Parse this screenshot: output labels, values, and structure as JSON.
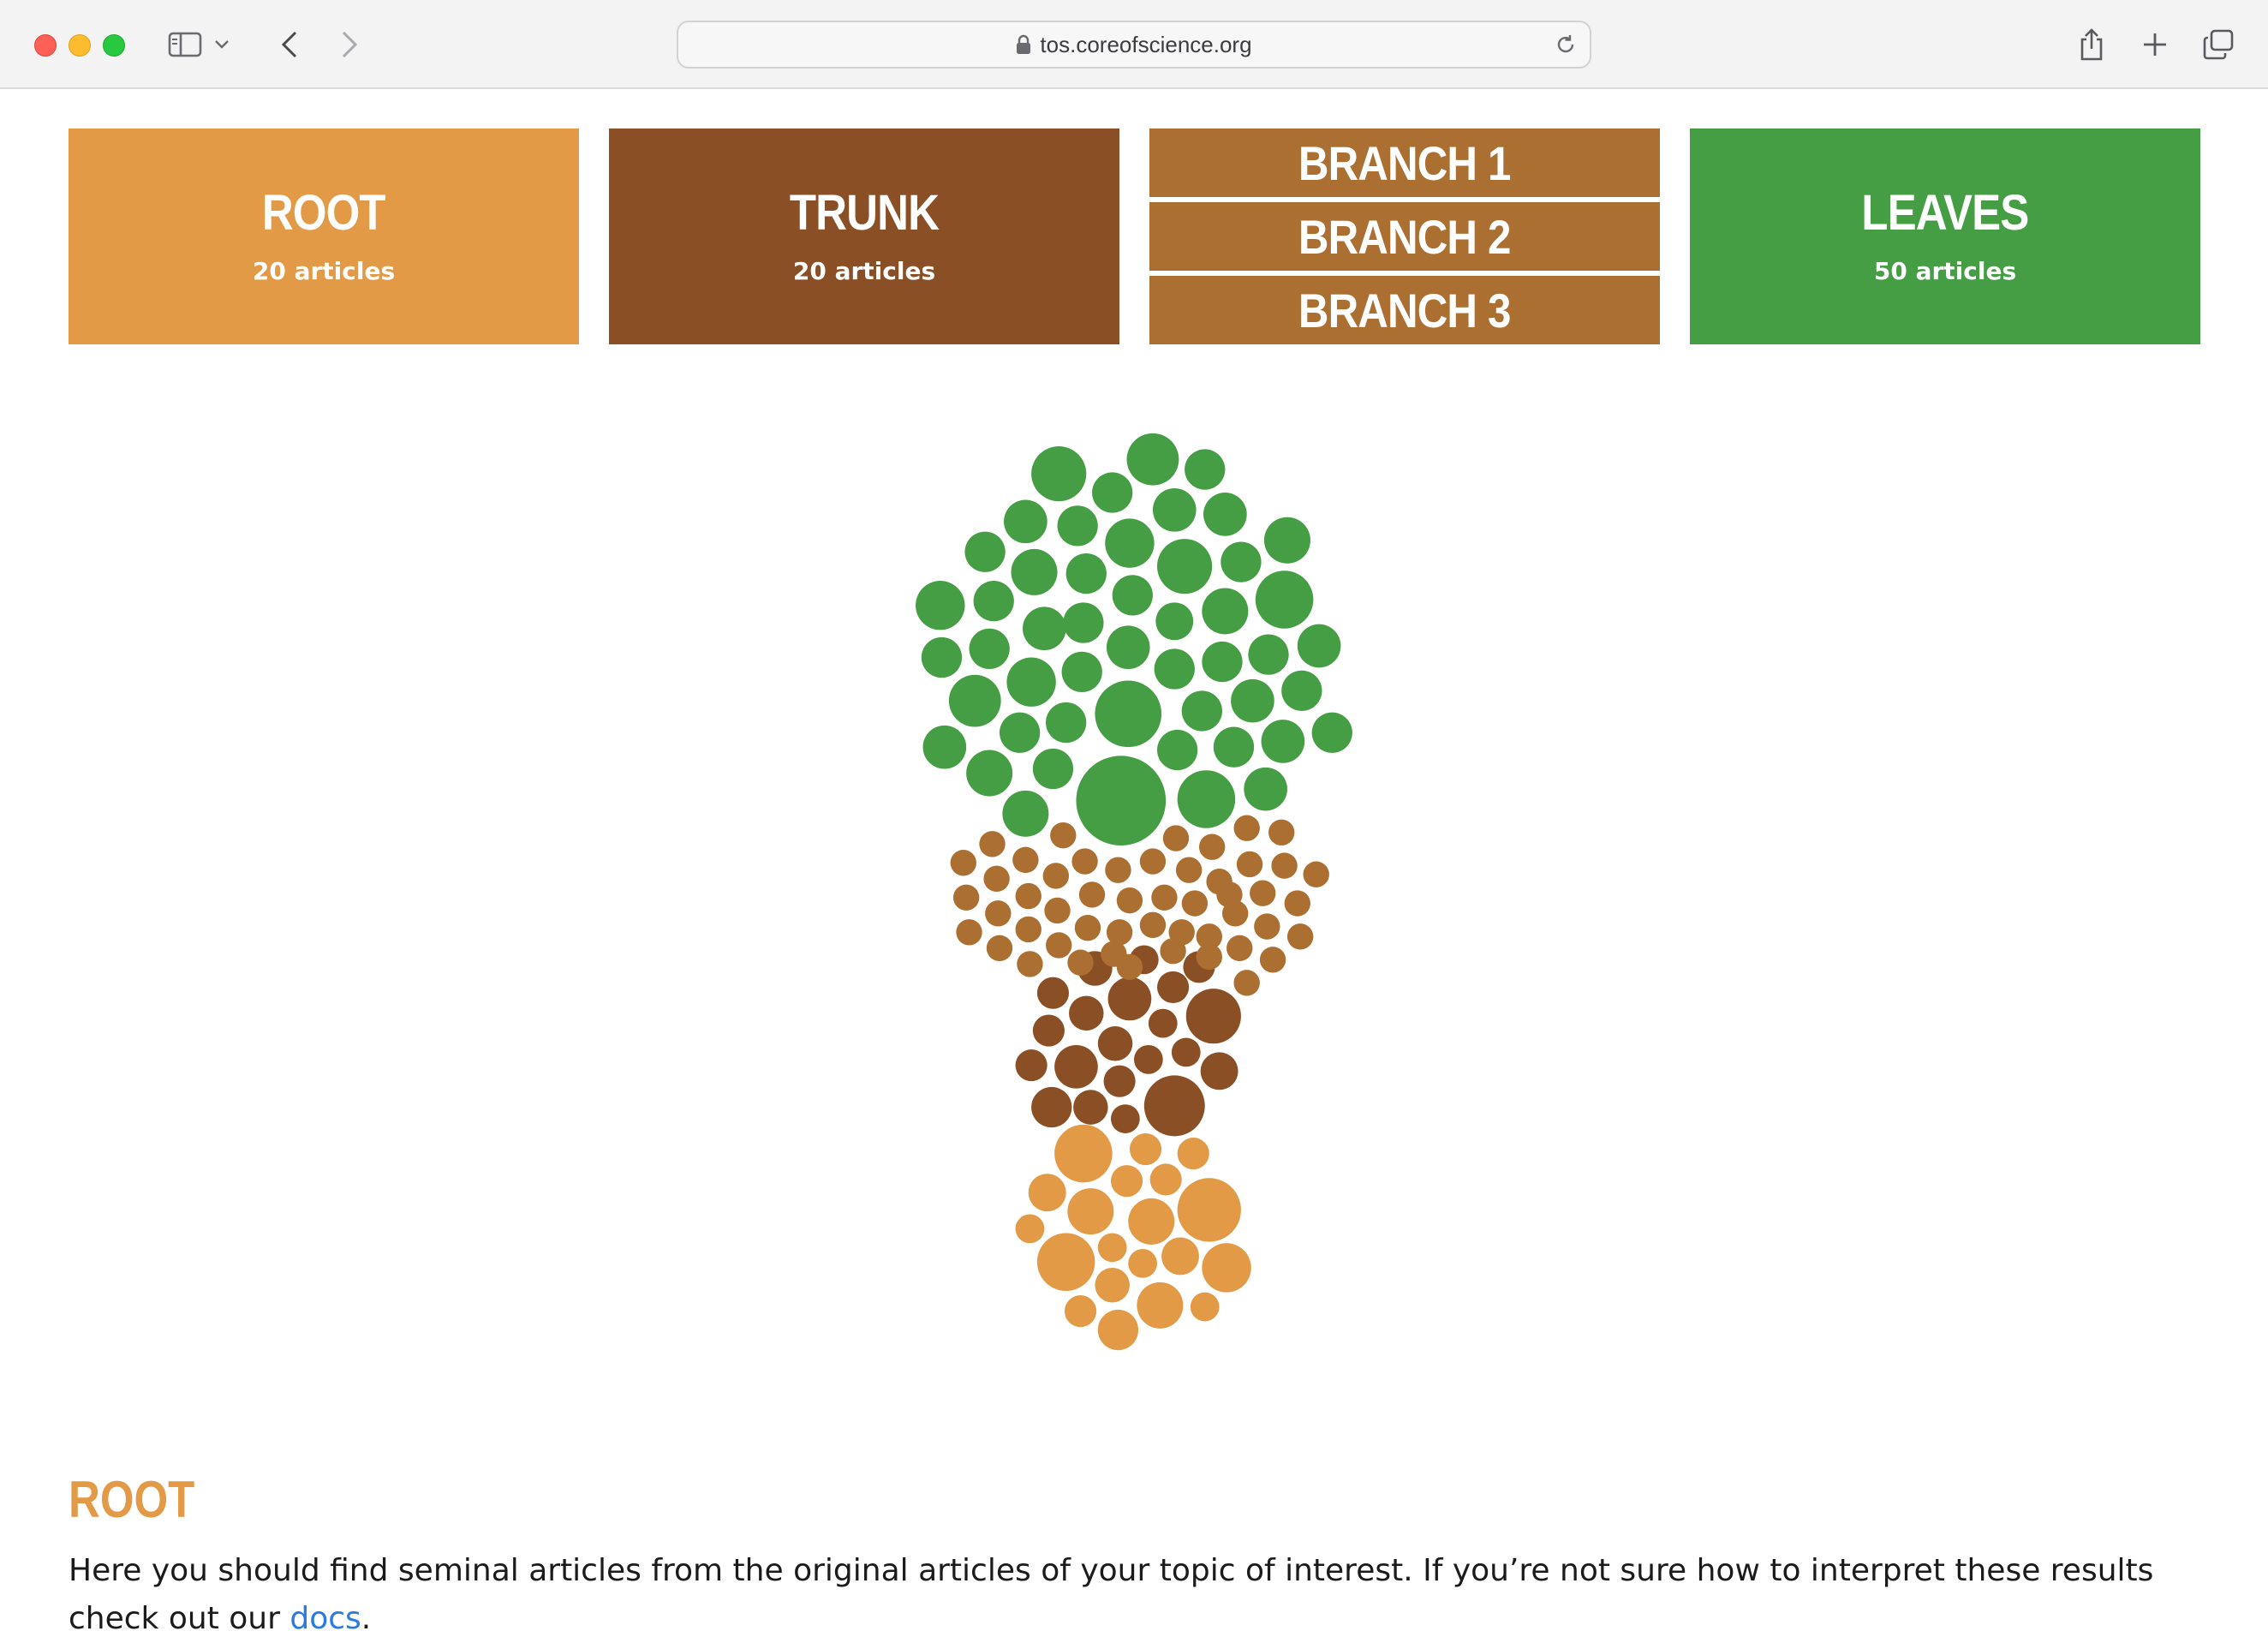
{
  "browser": {
    "url": "tos.coreofscience.org"
  },
  "colors": {
    "root": "#e29a47",
    "trunk": "#8a4f24",
    "branch": "#ac6f32",
    "leaves": "#459d44"
  },
  "categories": {
    "root": {
      "title": "ROOT",
      "count": "20 articles"
    },
    "trunk": {
      "title": "TRUNK",
      "count": "20 articles"
    },
    "branches": [
      "BRANCH 1",
      "BRANCH 2",
      "BRANCH 3"
    ],
    "leaves": {
      "title": "LEAVES",
      "count": "50 articles"
    }
  },
  "section": {
    "title": "ROOT",
    "text": "Here you should find seminal articles from the original articles of your topic of interest. If you’re not sure how to interpret these results check out our",
    "link": "docs",
    "end": "."
  }
}
